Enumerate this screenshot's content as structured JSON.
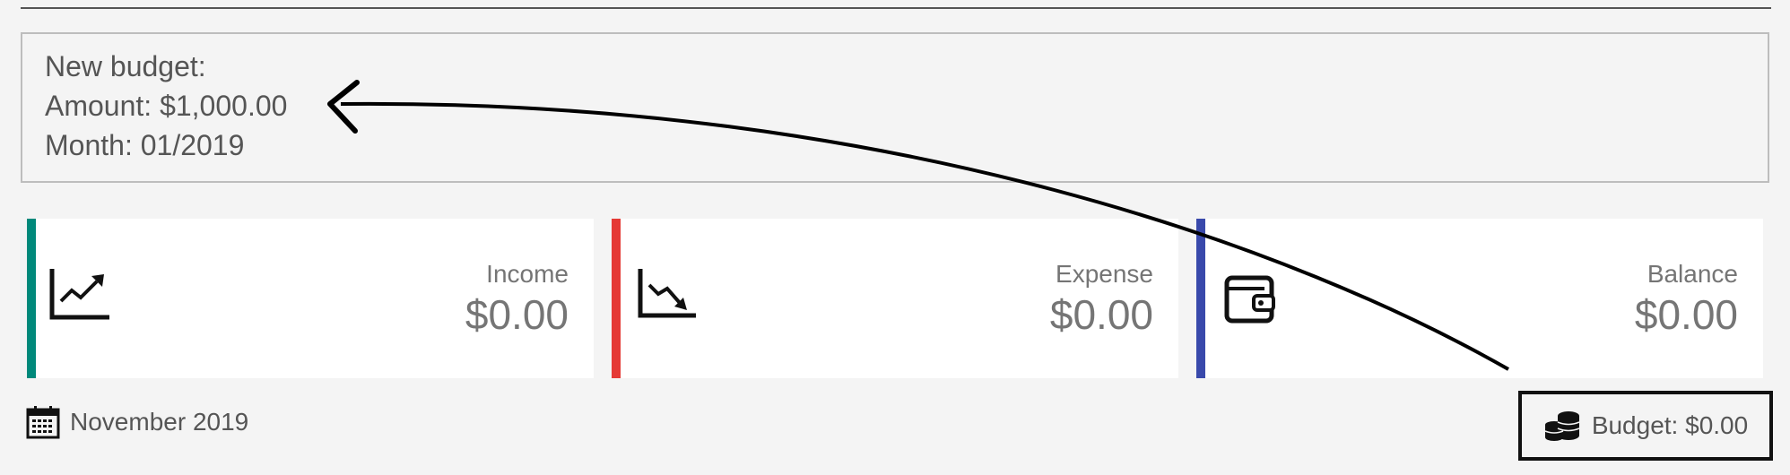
{
  "result": {
    "line1": "New budget:",
    "line2": "Amount: $1,000.00",
    "line3": "Month: 01/2019"
  },
  "cards": [
    {
      "label": "Income",
      "value": "$0.00",
      "accent": "#00897b",
      "icon": "trending-up-chart-icon"
    },
    {
      "label": "Expense",
      "value": "$0.00",
      "accent": "#e53935",
      "icon": "trending-down-chart-icon"
    },
    {
      "label": "Balance",
      "value": "$0.00",
      "accent": "#3949ab",
      "icon": "wallet-icon"
    }
  ],
  "footer": {
    "date": "November 2019",
    "date_icon": "calendar-icon",
    "budget": "Budget: $0.00",
    "budget_icon": "coins-icon"
  }
}
